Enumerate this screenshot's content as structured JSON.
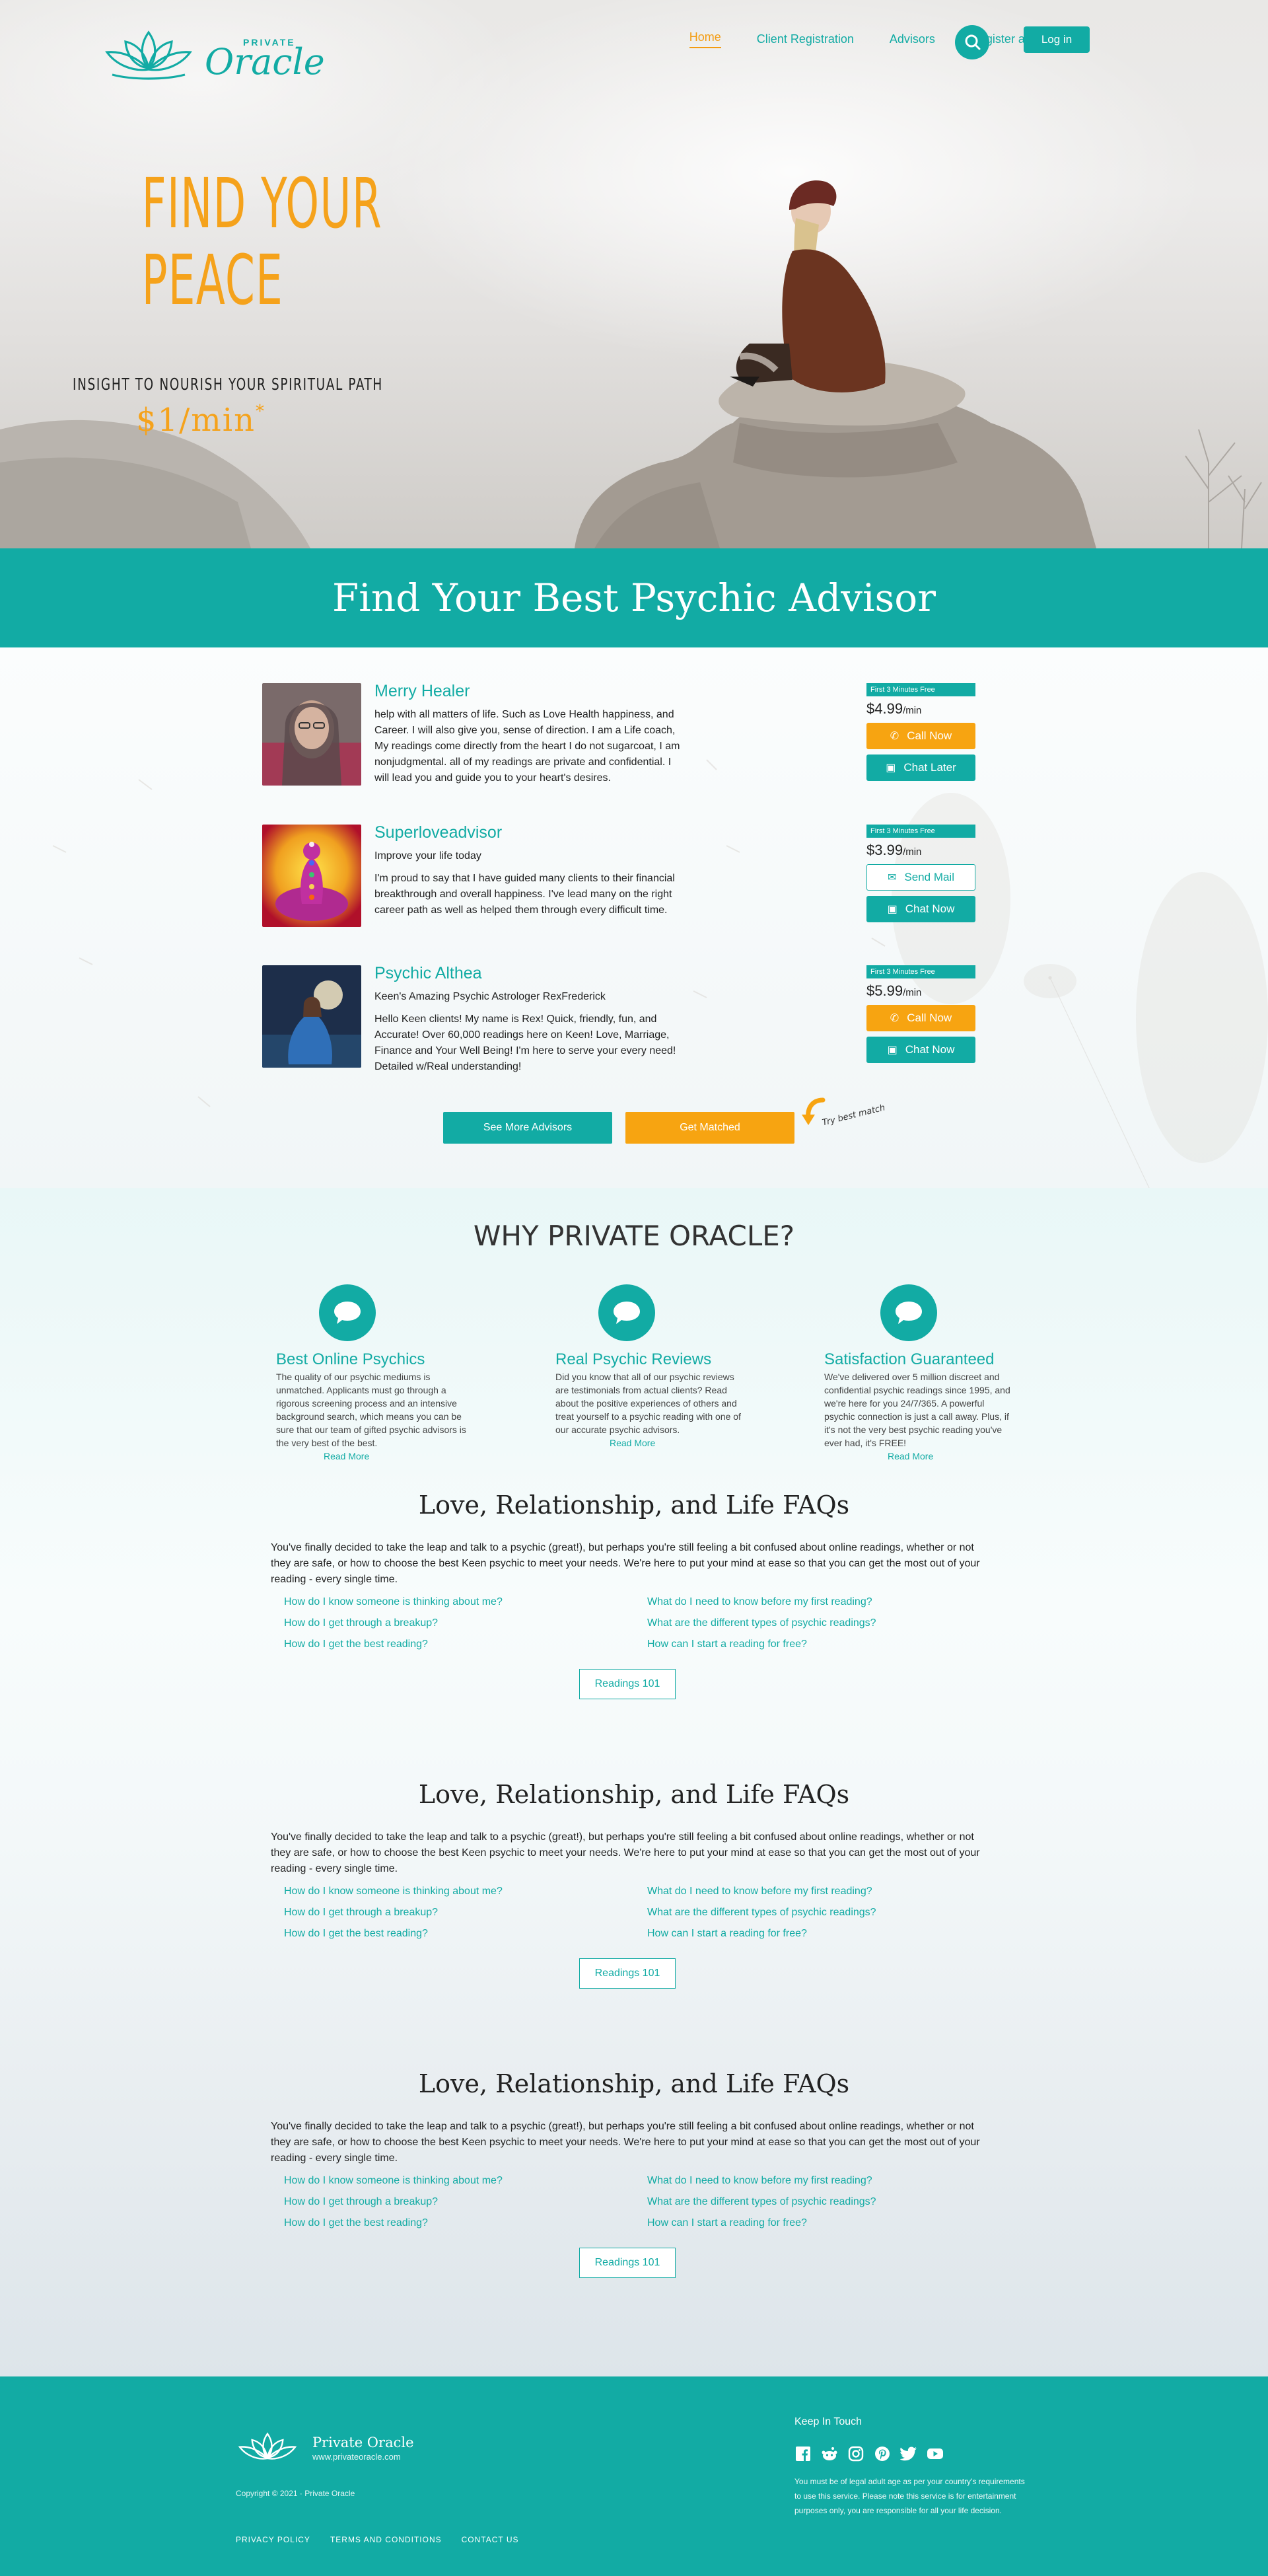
{
  "brand": {
    "small": "PRIVATE",
    "name": "Oracle"
  },
  "nav": [
    {
      "label": "Home",
      "active": true
    },
    {
      "label": "Client Registration"
    },
    {
      "label": "Advisors"
    },
    {
      "label": "Register as an Advisor"
    }
  ],
  "login_label": "Log in",
  "hero": {
    "title_line1": "FIND YOUR",
    "title_line2": "PEACE",
    "subtitle": "INSIGHT TO NOURISH YOUR SPIRITUAL PATH",
    "price": "$1/min",
    "price_mark": "*"
  },
  "band_title": "Find Your Best Psychic Advisor",
  "advisors": [
    {
      "name": "Merry Healer",
      "tagline": "",
      "bio": "help with all matters of life. Such as Love Health happiness, and Career. I will also give you, sense of direction. I am a Life coach, My readings come directly from the heart I do not sugarcoat, I am nonjudgmental. all of my readings are private and confidential. I will lead you and guide you to your heart's desires.",
      "badge": "First 3 Minutes Free",
      "price": "$4.99",
      "unit": "/min",
      "btn1": "Call Now",
      "btn2": "Chat Later"
    },
    {
      "name": "Superloveadvisor",
      "tagline": "Improve your life today",
      "bio": "I'm proud to say that I have guided many clients to their financial breakthrough and overall happiness. I've lead many on the right career path as well as helped them through every difficult time.",
      "badge": "First 3 Minutes Free",
      "price": "$3.99",
      "unit": "/min",
      "btn1": "Send Mail",
      "btn2": "Chat Now"
    },
    {
      "name": "Psychic Althea",
      "tagline": "Keen's Amazing Psychic Astrologer RexFrederick",
      "bio": "Hello Keen clients! My name is Rex! Quick, friendly, fun, and Accurate! Over 60,000 readings here on Keen! Love, Marriage, Finance and Your Well Being! I'm here to serve your every need! Detailed w/Real understanding!",
      "badge": "First 3 Minutes Free",
      "price": "$5.99",
      "unit": "/min",
      "btn1": "Call Now",
      "btn2": "Chat Now"
    }
  ],
  "see_more": "See More Advisors",
  "get_matched": "Get Matched",
  "try_note": "Try best match",
  "why": {
    "title": "WHY PRIVATE ORACLE?",
    "features": [
      {
        "title": "Best Online Psychics",
        "text": "The quality of our psychic mediums is unmatched. Applicants must go through a rigorous screening process and an intensive background search, which means you can be sure that our team of gifted psychic advisors is the very best of the best.",
        "link": "Read More"
      },
      {
        "title": "Real Psychic Reviews",
        "text": "Did you know that all of our psychic reviews are testimonials from actual clients? Read about the positive experiences of others and treat yourself to a psychic reading with one of our accurate psychic advisors.",
        "link": "Read More"
      },
      {
        "title": "Satisfaction Guaranteed",
        "text": "We've delivered over 5 million discreet and confidential psychic readings since 1995, and we're here for you 24/7/365. A powerful psychic connection is just a call away. Plus, if it's not the very best psychic reading you've ever had, it's FREE!",
        "link": "Read More"
      }
    ]
  },
  "faq": {
    "title": "Love, Relationship, and Life FAQs",
    "intro": "You've finally decided to take the leap and talk to a psychic (great!), but perhaps you're still feeling a bit confused about online readings, whether or not they are safe, or how to choose the best Keen psychic to meet your needs. We're here to put your mind at ease so that you can get the most out of your reading - every single time.",
    "left": [
      "How do I know someone is thinking about me?",
      "How do I get through a breakup?",
      "How do I get the best reading?"
    ],
    "right": [
      "What do I need to know before my first reading?",
      "What are the different types of psychic readings?",
      "How can I start a reading for free?"
    ],
    "button": "Readings 101"
  },
  "footer": {
    "name": "Private Oracle",
    "url": "www.privateoracle.com",
    "copyright": "Copyright © 2021 · Private Oracle",
    "links": [
      "PRIVACY POLICY",
      "TERMS AND CONDITIONS",
      "CONTACT US"
    ],
    "keep": "Keep In Touch",
    "disclaimer": "You must be of legal adult age as per your country's requirements to use this service. Please note this service is for entertainment purposes only, you are responsible for all your life decision.",
    "socials": [
      "facebook-icon",
      "reddit-icon",
      "instagram-icon",
      "pinterest-icon",
      "twitter-icon",
      "youtube-icon"
    ]
  },
  "colors": {
    "teal": "#12aba4",
    "orange": "#f7a411"
  }
}
